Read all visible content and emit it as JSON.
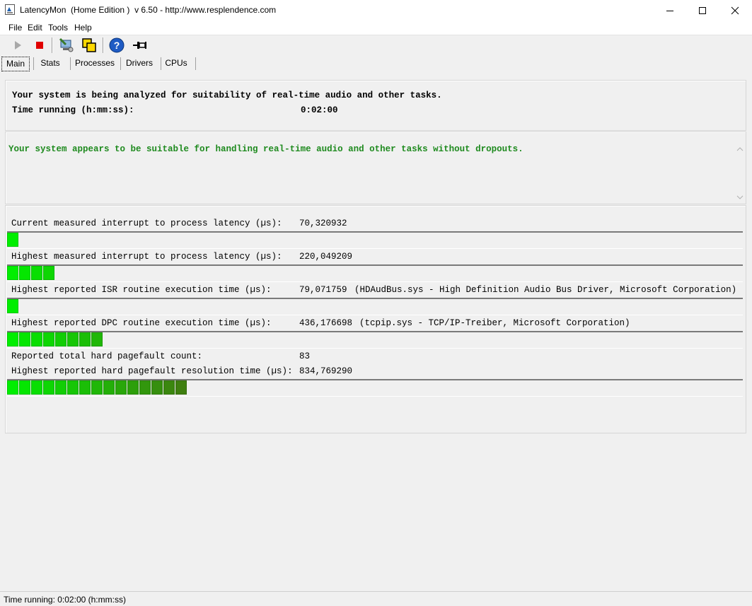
{
  "window": {
    "title": "LatencyMon  (Home Edition )  v 6.50 - http://www.resplendence.com"
  },
  "menu": [
    "File",
    "Edit",
    "Tools",
    "Help"
  ],
  "toolbar": [
    "play-icon",
    "stop-icon",
    "monitor-wrench-icon",
    "windows-icon",
    "help-icon",
    "pin-icon"
  ],
  "tabs": [
    "Main",
    "Stats",
    "Processes",
    "Drivers",
    "CPUs"
  ],
  "header": {
    "analyzing": "Your system is being analyzed for suitability of real-time audio and other tasks.",
    "time_label": "Time running (h:mm:ss):",
    "time_value": "0:02:00"
  },
  "conclusion": "Your system appears to be suitable for handling real-time audio and other tasks without dropouts.",
  "metrics": [
    {
      "label": "Current measured interrupt to process latency (µs):",
      "value": "70,320932",
      "detail": "",
      "segments": 1
    },
    {
      "label": "Highest measured interrupt to process latency (µs):",
      "value": "220,049209",
      "detail": "",
      "segments": 4
    },
    {
      "label": "Highest reported ISR routine execution time (µs):",
      "value": "79,071759",
      "detail": "(HDAudBus.sys - High Definition Audio Bus Driver, Microsoft Corporation)",
      "segments": 1
    },
    {
      "label": "Highest reported DPC routine execution time (µs):",
      "value": "436,176698",
      "detail": "(tcpip.sys - TCP/IP-Treiber, Microsoft Corporation)",
      "segments": 8
    },
    {
      "label": "Reported total hard pagefault count:",
      "value": "83",
      "detail": ""
    },
    {
      "label": "Highest reported hard pagefault resolution time (µs):",
      "value": "834,769290",
      "detail": "",
      "segments": 15
    }
  ],
  "status": "Time running: 0:02:00  (h:mm:ss)",
  "colors": {
    "ok_text": "#1e8a1e",
    "bar_light": "#00ee00",
    "bar_dark": "#3f7f10"
  }
}
